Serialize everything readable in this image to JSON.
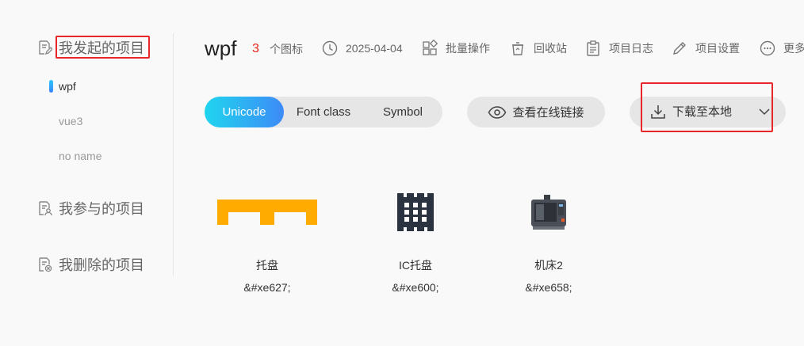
{
  "sidebar": {
    "my_projects": "我发起的项目",
    "projects": [
      "wpf",
      "vue3",
      "no name"
    ],
    "participated": "我参与的项目",
    "deleted": "我删除的项目"
  },
  "header": {
    "project_name": "wpf",
    "icon_count": "3",
    "icon_count_unit": "个图标",
    "date": "2025-04-04",
    "batch": "批量操作",
    "recycle": "回收站",
    "log": "项目日志",
    "settings": "项目设置",
    "more": "更多"
  },
  "toolbar": {
    "tabs": [
      "Unicode",
      "Font class",
      "Symbol"
    ],
    "active_tab": "Unicode",
    "view_online_link": "查看在线链接",
    "download": "下载至本地"
  },
  "icons": [
    {
      "name": "托盘",
      "code": "&#xe627;",
      "color": "#ffab00"
    },
    {
      "name": "IC托盘",
      "code": "&#xe600;",
      "color": "#2b3340"
    },
    {
      "name": "机床2",
      "code": "&#xe658;",
      "color": "#4a4f57"
    }
  ],
  "colors": {
    "accent_start": "#1fd5ee",
    "accent_end": "#3d8bf7",
    "highlight_box": "#e8262a",
    "count_red": "#e6251d"
  }
}
